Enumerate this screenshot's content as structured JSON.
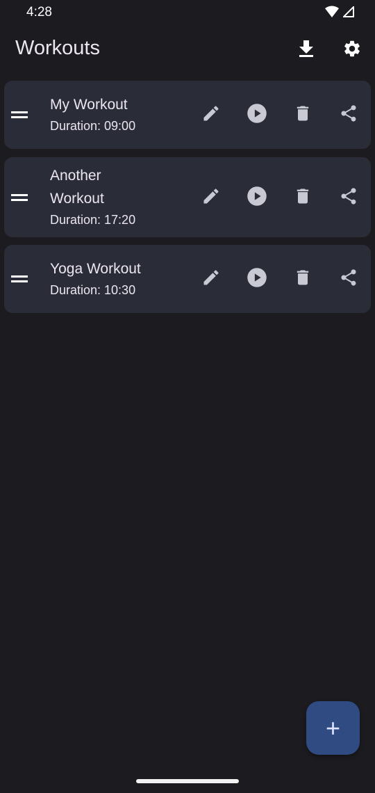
{
  "status_bar": {
    "time": "4:28"
  },
  "app_bar": {
    "title": "Workouts",
    "download_icon": "download-icon",
    "settings_icon": "gear-icon"
  },
  "workouts": [
    {
      "title": "My Workout",
      "duration": "Duration: 09:00"
    },
    {
      "title": "Another Workout",
      "duration": "Duration: 17:20"
    },
    {
      "title": "Yoga Workout",
      "duration": "Duration: 10:30"
    }
  ],
  "row_actions": [
    "edit-icon",
    "play-icon",
    "delete-icon",
    "share-icon"
  ],
  "fab": {
    "label": "+"
  },
  "colors": {
    "background": "#1c1b20",
    "card": "#2a2d38",
    "fab": "#2f4b82",
    "icon": "#c8c9d2"
  }
}
